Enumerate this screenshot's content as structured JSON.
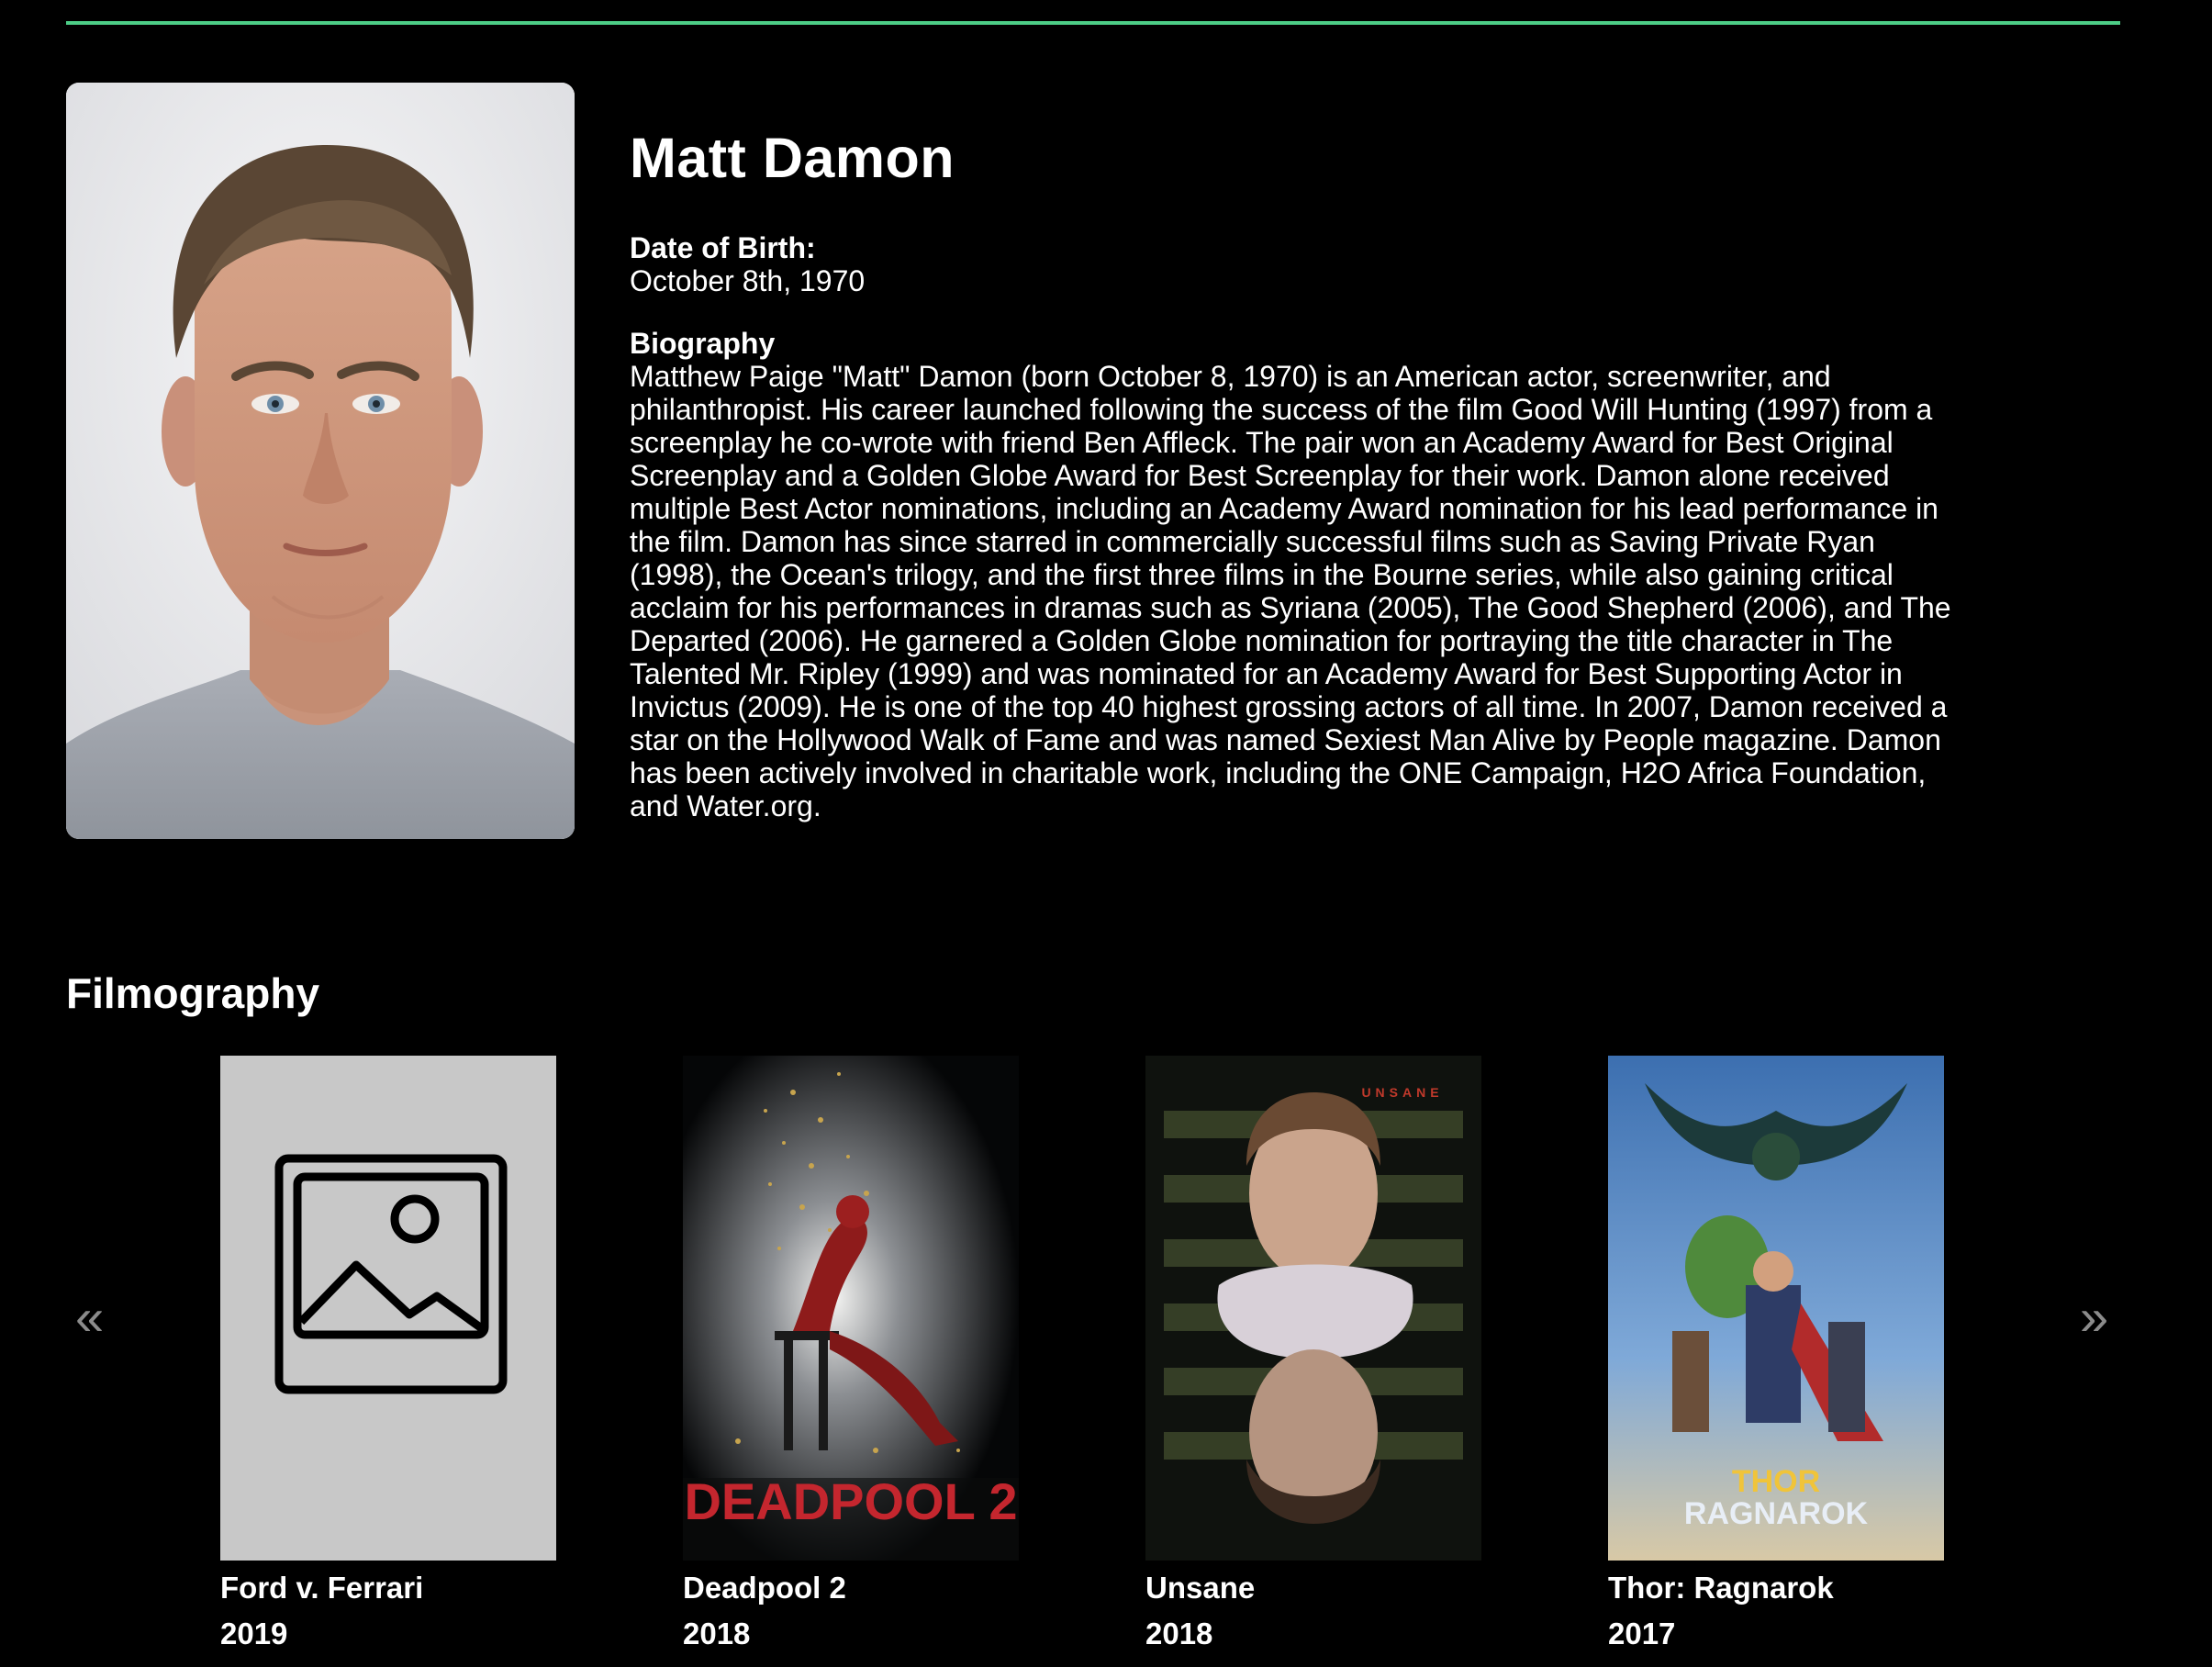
{
  "actor": {
    "name": "Matt Damon",
    "dob_label": "Date of Birth:",
    "dob_value": "October 8th, 1970",
    "bio_label": "Biography",
    "bio_text": "Matthew Paige \"Matt\" Damon (born October 8, 1970) is an American actor, screenwriter, and philanthropist. His career launched following the success of the film Good Will Hunting (1997) from a screenplay he co-wrote with friend Ben Affleck. The pair won an Academy Award for Best Original Screenplay and a Golden Globe Award for Best Screenplay for their work. Damon alone received multiple Best Actor nominations, including an Academy Award nomination for his lead performance in the film. Damon has since starred in commercially successful films such as Saving Private Ryan (1998), the Ocean's trilogy, and the first three films in the Bourne series, while also gaining critical acclaim for his performances in dramas such as Syriana (2005), The Good Shepherd (2006), and The Departed (2006). He garnered a Golden Globe nomination for portraying the title character in The Talented Mr. Ripley (1999) and was nominated for an Academy Award for Best Supporting Actor in Invictus (2009). He is one of the top 40 highest grossing actors of all time. In 2007, Damon received a star on the Hollywood Walk of Fame and was named Sexiest Man Alive by People magazine. Damon has been actively involved in charitable work, including the ONE Campaign, H2O Africa Foundation, and Water.org."
  },
  "filmography": {
    "title": "Filmography",
    "prev_icon": "chevron-double-left-icon",
    "prev_glyph": "«",
    "next_icon": "chevron-double-right-icon",
    "next_glyph": "»",
    "films": [
      {
        "title": "Ford v. Ferrari",
        "year": "2019"
      },
      {
        "title": "Deadpool 2",
        "year": "2018",
        "poster_text": "DEADPOOL 2"
      },
      {
        "title": "Unsane",
        "year": "2018",
        "poster_text": "UNSANE"
      },
      {
        "title": "Thor: Ragnarok",
        "year": "2017",
        "poster_text_top": "THOR",
        "poster_text_bottom": "RAGNAROK"
      }
    ]
  },
  "colors": {
    "accent": "#4ccd86",
    "background": "#000000",
    "placeholder_bg": "#c8c8c8",
    "arrow": "#8b8b8b"
  }
}
